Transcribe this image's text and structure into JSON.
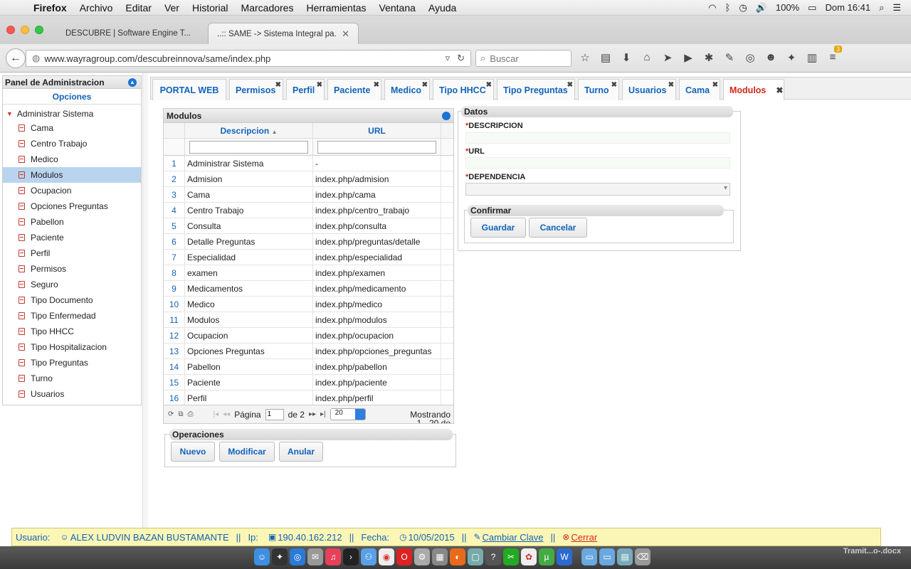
{
  "menubar": {
    "app": "Firefox",
    "items": [
      "Archivo",
      "Editar",
      "Ver",
      "Historial",
      "Marcadores",
      "Herramientas",
      "Ventana",
      "Ayuda"
    ],
    "battery": "100%",
    "clock": "Dom 16:41"
  },
  "browser_tabs": [
    {
      "title": "DESCUBRE | Software Engine T..."
    },
    {
      "title": "..:: SAME -> Sistema Integral pa..."
    }
  ],
  "navbar": {
    "url": "www.wayragroup.com/descubreinnova/same/index.php",
    "search_placeholder": "Buscar",
    "badge": "3"
  },
  "left_panel": {
    "title": "Panel de Administracion",
    "subtitle": "Opciones",
    "root": "Administrar Sistema",
    "items": [
      "Cama",
      "Centro Trabajo",
      "Medico",
      "Modulos",
      "Ocupacion",
      "Opciones Preguntas",
      "Pabellon",
      "Paciente",
      "Perfil",
      "Permisos",
      "Seguro",
      "Tipo Documento",
      "Tipo Enfermedad",
      "Tipo HHCC",
      "Tipo Hospitalizacion",
      "Tipo Preguntas",
      "Turno",
      "Usuarios"
    ],
    "selected": "Modulos"
  },
  "app_tabs": {
    "items": [
      "PORTAL WEB",
      "Permisos",
      "Perfil",
      "Paciente",
      "Medico",
      "Tipo HHCC",
      "Tipo Preguntas",
      "Turno",
      "Usuarios",
      "Cama",
      "Modulos"
    ],
    "active": "Modulos"
  },
  "grid": {
    "title": "Modulos",
    "columns": [
      "Descripcion",
      "URL"
    ],
    "rows": [
      [
        "1",
        "Administrar Sistema",
        "-"
      ],
      [
        "2",
        "Admision",
        "index.php/admision"
      ],
      [
        "3",
        "Cama",
        "index.php/cama"
      ],
      [
        "4",
        "Centro Trabajo",
        "index.php/centro_trabajo"
      ],
      [
        "5",
        "Consulta",
        "index.php/consulta"
      ],
      [
        "6",
        "Detalle Preguntas",
        "index.php/preguntas/detalle"
      ],
      [
        "7",
        "Especialidad",
        "index.php/especialidad"
      ],
      [
        "8",
        "examen",
        "index.php/examen"
      ],
      [
        "9",
        "Medicamentos",
        "index.php/medicamento"
      ],
      [
        "10",
        "Medico",
        "index.php/medico"
      ],
      [
        "11",
        "Modulos",
        "index.php/modulos"
      ],
      [
        "12",
        "Ocupacion",
        "index.php/ocupacion"
      ],
      [
        "13",
        "Opciones Preguntas",
        "index.php/opciones_preguntas"
      ],
      [
        "14",
        "Pabellon",
        "index.php/pabellon"
      ],
      [
        "15",
        "Paciente",
        "index.php/paciente"
      ],
      [
        "16",
        "Perfil",
        "index.php/perfil"
      ]
    ],
    "pager": {
      "page_label": "Página",
      "page_value": "1",
      "of_label": "de 2",
      "page_size": "20",
      "showing": "Mostrando 1 - 20 de"
    }
  },
  "operaciones": {
    "title": "Operaciones",
    "buttons": [
      "Nuevo",
      "Modificar",
      "Anular"
    ]
  },
  "datos": {
    "title": "Datos",
    "required_mark": "*",
    "fields": [
      "DESCRIPCION",
      "URL",
      "DEPENDENCIA"
    ],
    "confirm_title": "Confirmar",
    "save": "Guardar",
    "cancel": "Cancelar"
  },
  "status": {
    "user_label": "Usuario:",
    "user": "ALEX LUDVIN BAZAN BUSTAMANTE",
    "sep": "||",
    "ip_label": "Ip:",
    "ip": "190.40.162.212",
    "date_label": "Fecha:",
    "date": "10/05/2015",
    "change_password": "Cambiar Clave",
    "logout": "Cerrar"
  },
  "dock": {
    "label": "Tramit...o-.docx"
  }
}
